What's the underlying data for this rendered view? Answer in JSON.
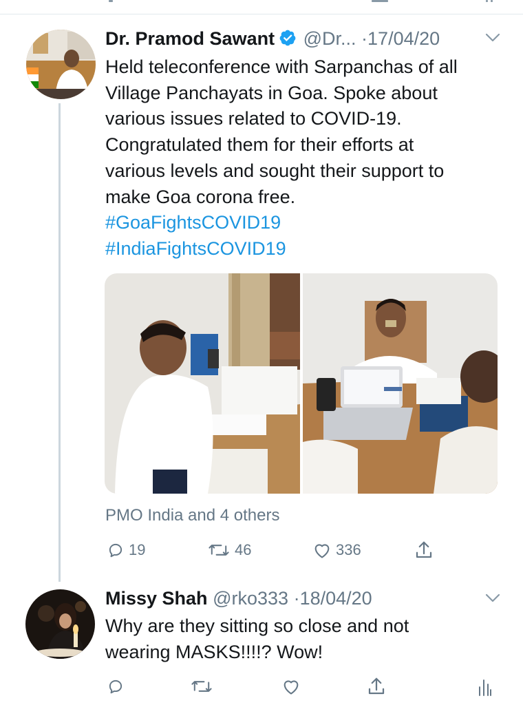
{
  "tweet": {
    "author_name": "Dr. Pramod Sawant",
    "handle": "@Dr...",
    "separator": "·",
    "date": "17/04/20",
    "text_lines": [
      "Held teleconference with Sarpanchas of all",
      "Village Panchayats in Goa. Spoke about",
      "various issues related to COVID-19.",
      "Congratulated them for their efforts at",
      "various levels and sought their support to",
      "make Goa corona free."
    ],
    "hashtags": [
      "#GoaFightsCOVID19",
      "#IndiaFightsCOVID19"
    ],
    "social_context": "PMO India and 4 others",
    "replies": "19",
    "retweets": "46",
    "likes": "336"
  },
  "reply": {
    "author_name": "Missy Shah",
    "handle": "@rko333",
    "separator": "·",
    "date": "18/04/20",
    "text_lines": [
      "Why are they sitting so close and not",
      "wearing MASKS!!!!? Wow!"
    ]
  },
  "icons": {
    "verified": "verified-badge-icon",
    "chevron": "chevron-down-icon",
    "reply": "reply-icon",
    "retweet": "retweet-icon",
    "like": "heart-icon",
    "share": "share-icon",
    "analytics": "analytics-icon"
  },
  "colors": {
    "accent": "#1b95e0",
    "muted": "#657786",
    "text": "#14171a",
    "line": "#ccd6dd"
  }
}
